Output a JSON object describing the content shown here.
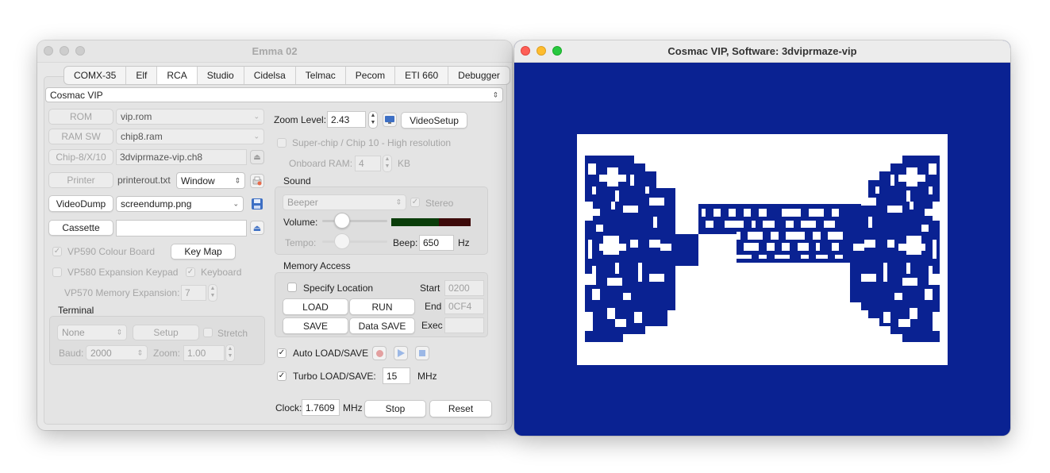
{
  "emma": {
    "title": "Emma 02",
    "tabs": [
      "COMX-35",
      "Elf",
      "RCA",
      "Studio",
      "Cidelsa",
      "Telmac",
      "Pecom",
      "ETI 660",
      "Debugger"
    ],
    "active_tab": "RCA",
    "machine_select": "Cosmac VIP",
    "rom_button": "ROM",
    "rom_value": "vip.rom",
    "ramsw_button": "RAM SW",
    "ramsw_value": "chip8.ram",
    "chip8_button": "Chip-8/X/10",
    "chip8_value": "3dviprmaze-vip.ch8",
    "printer_button": "Printer",
    "printer_value": "printerout.txt",
    "printer_mode": "Window",
    "videodump_button": "VideoDump",
    "videodump_value": "screendump.png",
    "cassette_button": "Cassette",
    "cassette_value": "",
    "vp590_label": "VP590 Colour Board",
    "keymap_button": "Key Map",
    "vp580_label": "VP580 Expansion Keypad",
    "keyboard_label": "Keyboard",
    "vp570_label": "VP570 Memory Expansion:",
    "vp570_value": "7",
    "terminal_label": "Terminal",
    "terminal_select": "None",
    "setup_button": "Setup",
    "stretch_label": "Stretch",
    "baud_label": "Baud:",
    "baud_value": "2000",
    "zoom_small_label": "Zoom:",
    "zoom_small_value": "1.00",
    "zoom_level_label": "Zoom Level:",
    "zoom_level_value": "2.43",
    "videosetup_button": "VideoSetup",
    "superchip_label": "Super-chip / Chip 10 - High resolution",
    "onboard_ram_label": "Onboard RAM:",
    "onboard_ram_value": "4",
    "onboard_ram_unit": "KB",
    "sound_label": "Sound",
    "sound_select": "Beeper",
    "stereo_label": "Stereo",
    "volume_label": "Volume:",
    "tempo_label": "Tempo:",
    "beep_label": "Beep:",
    "beep_value": "650",
    "beep_unit": "Hz",
    "memory_access_label": "Memory Access",
    "specify_location_label": "Specify Location",
    "start_label": "Start",
    "start_value": "0200",
    "end_label": "End",
    "end_value": "0CF4",
    "exec_label": "Exec",
    "exec_value": "",
    "load_button": "LOAD",
    "run_button": "RUN",
    "save_button": "SAVE",
    "data_save_button": "Data SAVE",
    "auto_load_label": "Auto LOAD/SAVE",
    "turbo_label": "Turbo LOAD/SAVE:",
    "turbo_value": "15",
    "turbo_unit": "MHz",
    "clock_label": "Clock:",
    "clock_value": "1.7609",
    "clock_unit": "MHz",
    "stop_button": "Stop",
    "reset_button": "Reset"
  },
  "vip": {
    "title": "Cosmac VIP, Software: 3dviprmaze-vip",
    "colors": {
      "background": "#0a2292",
      "foreground": "#ffffff"
    }
  }
}
